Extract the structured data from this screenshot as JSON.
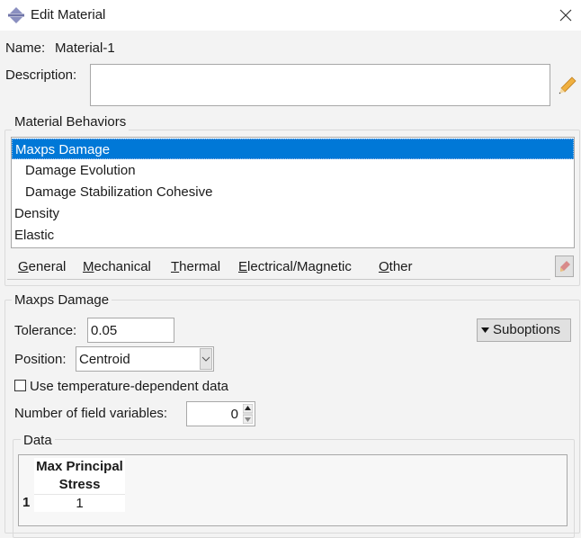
{
  "window": {
    "title": "Edit Material",
    "close_icon": "close-icon",
    "app_icon": "abaqus-diamond-icon"
  },
  "name": {
    "label": "Name:",
    "value": "Material-1"
  },
  "description": {
    "label": "Description:",
    "value": "",
    "edit_icon": "pencil-icon"
  },
  "behaviors": {
    "title": "Material Behaviors",
    "items": [
      {
        "label": "Maxps Damage",
        "selected": true
      },
      {
        "label": "Damage Evolution",
        "indent": true
      },
      {
        "label": "Damage Stabilization Cohesive",
        "indent": true
      },
      {
        "label": "Density"
      },
      {
        "label": "Elastic"
      }
    ],
    "menu": [
      {
        "key": "G",
        "rest": "eneral"
      },
      {
        "key": "M",
        "rest": "echanical"
      },
      {
        "key": "T",
        "rest": "hermal"
      },
      {
        "key": "E",
        "rest": "lectrical/Magnetic"
      },
      {
        "key": "O",
        "rest": "ther"
      }
    ],
    "delete_icon": "eraser-icon"
  },
  "section": {
    "title": "Maxps Damage",
    "tolerance": {
      "label": "Tolerance:",
      "value": "0.05"
    },
    "suboptions": "Suboptions",
    "position": {
      "label": "Position:",
      "value": "Centroid"
    },
    "temp_dependent": {
      "label": "Use temperature-dependent data",
      "checked": false
    },
    "field_vars": {
      "label": "Number of field variables:",
      "value": "0"
    },
    "data": {
      "title": "Data",
      "header_line1": "Max Principal",
      "header_line2": "Stress",
      "rows": [
        {
          "index": "1",
          "value": "1"
        }
      ]
    }
  }
}
